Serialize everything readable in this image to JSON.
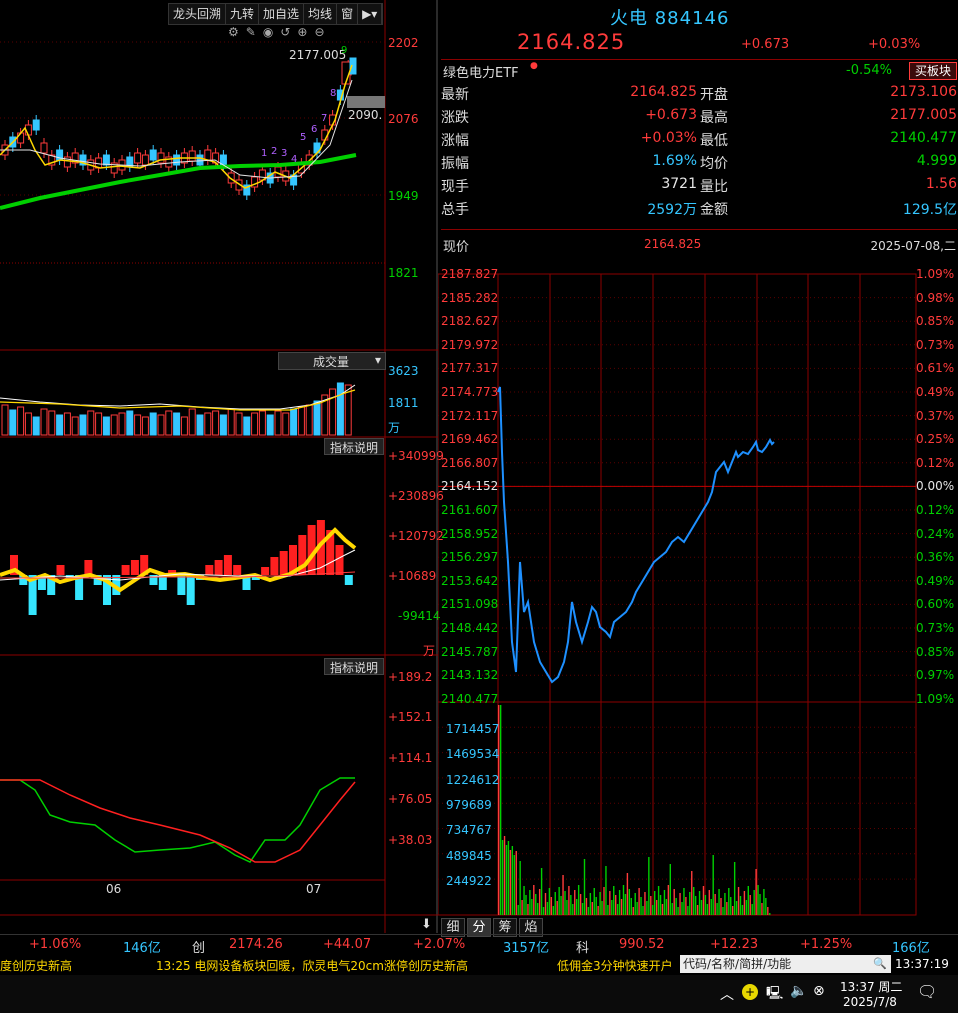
{
  "toolbar": {
    "items": [
      "龙头回溯",
      "九转",
      "加自选",
      "均线",
      "窗"
    ]
  },
  "kline": {
    "price_axis": [
      "2202",
      "2076",
      "1949",
      "1821"
    ],
    "high_label": "2177.005",
    "last_label": "2090.",
    "nine_turn_up": [
      "1",
      "2",
      "3",
      "4",
      "5",
      "6",
      "7",
      "8",
      "9"
    ],
    "volume_title": "成交量",
    "volume_axis": [
      "3623",
      "1811",
      "万"
    ],
    "indicator_btn": "指标说明",
    "macd_axis": [
      "+340999",
      "+230896",
      "+120792",
      "+10689",
      "-99414",
      "万"
    ],
    "indicator_btn2": "指标说明",
    "kdj_axis": [
      "+189.2",
      "+152.1",
      "+114.1",
      "+76.05",
      "+38.03"
    ],
    "months": [
      "06",
      "07"
    ]
  },
  "quote": {
    "name": "火电",
    "code": "884146",
    "price": "2164.825",
    "change": "+0.673",
    "change_pct": "+0.03%",
    "etf_name": "绿色电力ETF",
    "etf_pct": "-0.54%",
    "etf_btn": "买板块",
    "rows": [
      {
        "l1": "最新",
        "v1": "2164.825",
        "c1": "red",
        "l2": "开盘",
        "v2": "2173.106",
        "c2": "red"
      },
      {
        "l1": "涨跌",
        "v1": "+0.673",
        "c1": "red",
        "l2": "最高",
        "v2": "2177.005",
        "c2": "red"
      },
      {
        "l1": "涨幅",
        "v1": "+0.03%",
        "c1": "red",
        "l2": "最低",
        "v2": "2140.477",
        "c2": "green"
      },
      {
        "l1": "振幅",
        "v1": "1.69%",
        "c1": "cyan",
        "l2": "均价",
        "v2": "4.999",
        "c2": "green"
      },
      {
        "l1": "现手",
        "v1": "3721",
        "c1": "white",
        "l2": "量比",
        "v2": "1.56",
        "c2": "red"
      },
      {
        "l1": "总手",
        "v1": "2592万",
        "c1": "cyan",
        "l2": "金额",
        "v2": "129.5亿",
        "c2": "cyan"
      }
    ]
  },
  "intraday": {
    "label": "现价",
    "price": "2164.825",
    "date": "2025-07-08,二",
    "price_axis": [
      "2187.827",
      "2185.282",
      "2182.627",
      "2179.972",
      "2177.317",
      "2174.773",
      "2172.117",
      "2169.462",
      "2166.807",
      "2164.152",
      "2161.607",
      "2158.952",
      "2156.297",
      "2153.642",
      "2151.098",
      "2148.442",
      "2145.787",
      "2143.132",
      "2140.477"
    ],
    "pct_axis": [
      "1.09%",
      "0.98%",
      "0.85%",
      "0.73%",
      "0.61%",
      "0.49%",
      "0.37%",
      "0.25%",
      "0.12%",
      "0.00%",
      "0.12%",
      "0.24%",
      "0.36%",
      "0.49%",
      "0.60%",
      "0.73%",
      "0.85%",
      "0.97%",
      "1.09%"
    ],
    "vol_axis": [
      "1714457",
      "1469534",
      "1224612",
      "979689",
      "734767",
      "489845",
      "244922"
    ]
  },
  "tabs": [
    "细",
    "分",
    "筹",
    "焰"
  ],
  "index_bar": {
    "a_pct": "+1.06%",
    "a_amt": "146亿",
    "b_name": "创",
    "b_val": "2174.26",
    "b_chg": "+44.07",
    "b_pct": "+2.07%",
    "b_amt": "3157亿",
    "c_name": "科",
    "c_val": "990.52",
    "c_chg": "+12.23",
    "c_pct": "+1.25%",
    "c_amt": "166亿"
  },
  "ticker": {
    "t1": "度创历史新高",
    "t2": "13:25 电网设备板块回暖，欣灵电气20cm涨停创历史新高",
    "t3": "低佣金3分钟快速开户"
  },
  "search": {
    "placeholder": "代码/名称/简拼/功能"
  },
  "clock": "13:37:19",
  "taskbar": {
    "time": "13:37 周二",
    "date": "2025/7/8"
  },
  "colors": {
    "up": "#ff3b3b",
    "down": "#00d000",
    "price_line": "#1e90ff",
    "grid": "#8b0000"
  }
}
